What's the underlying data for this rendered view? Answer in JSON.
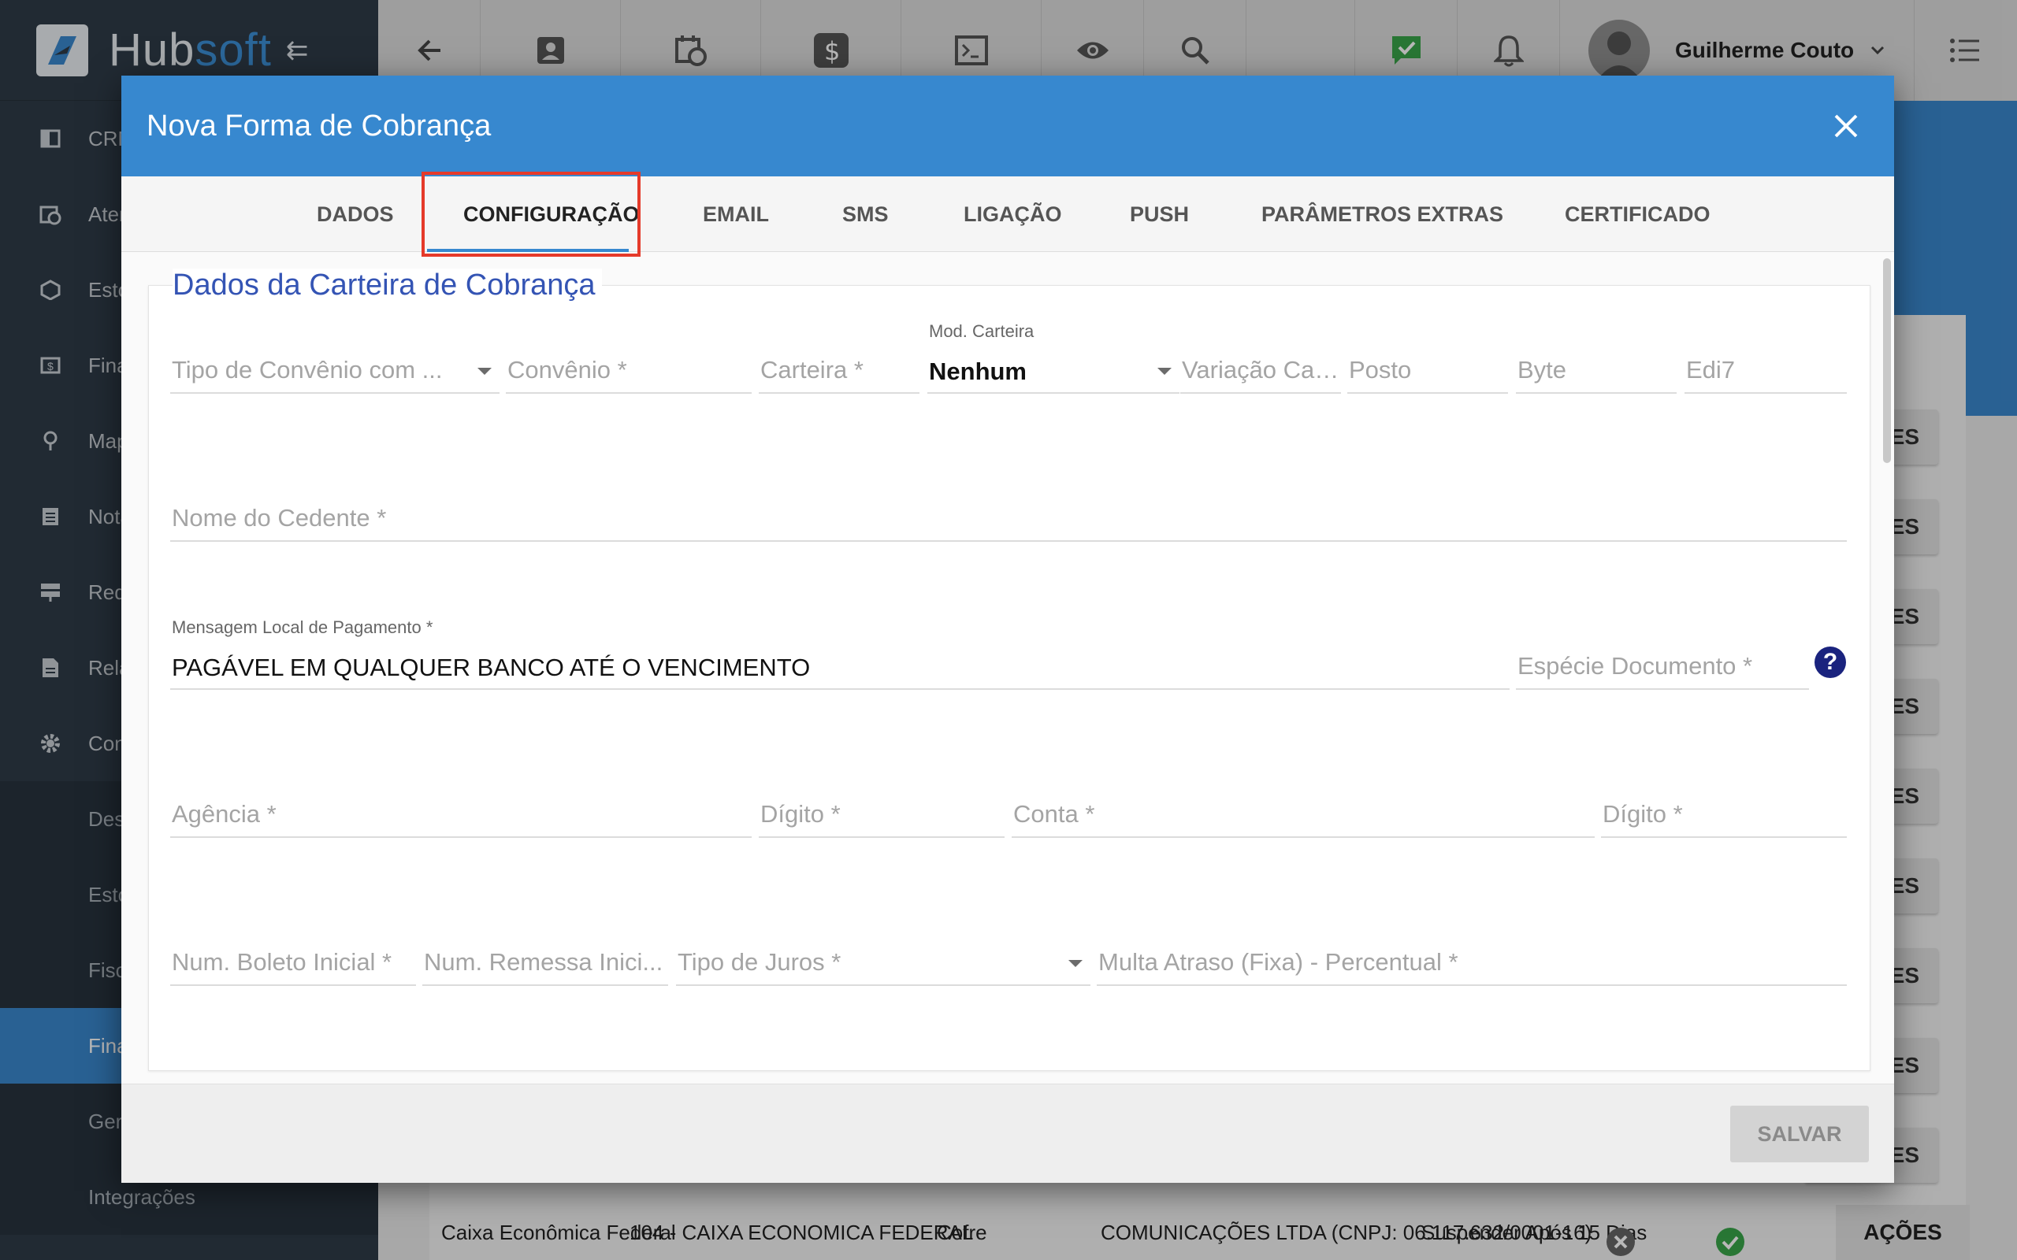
{
  "app": {
    "logo_main": "Hub",
    "logo_accent": "soft"
  },
  "sidebar": {
    "items": [
      {
        "label": "CRM",
        "icon": "crm-icon"
      },
      {
        "label": "Atendimento",
        "icon": "calendar-clock-icon"
      },
      {
        "label": "Estoque",
        "icon": "box-icon"
      },
      {
        "label": "Financeiro",
        "icon": "money-icon"
      },
      {
        "label": "Mapas",
        "icon": "map-pin-icon"
      },
      {
        "label": "Notas",
        "icon": "notes-icon"
      },
      {
        "label": "Redes",
        "icon": "network-icon"
      },
      {
        "label": "Relatórios",
        "icon": "report-icon"
      },
      {
        "label": "Configurações",
        "icon": "gear-icon"
      }
    ],
    "subitems": [
      {
        "label": "Despesas"
      },
      {
        "label": "Estoque"
      },
      {
        "label": "Fiscal"
      },
      {
        "label": "Financeiro",
        "active": true
      },
      {
        "label": "Geral"
      },
      {
        "label": "Integrações"
      }
    ]
  },
  "topbar": {
    "user_name": "Guilherme Couto"
  },
  "background": {
    "button_label": "AÇÕES",
    "row": {
      "col1": "Caixa Econômica Federal",
      "col2": "104 - CAIXA ECONOMICA FEDERAL",
      "col3": "Cofre",
      "col4": "COMUNICAÇÕES LTDA (CNPJ: 06.117.632/0001-16)",
      "col5": "Suspender Após 15 Dias"
    }
  },
  "modal": {
    "title": "Nova Forma de Cobrança",
    "tabs": [
      {
        "label": "DADOS"
      },
      {
        "label": "CONFIGURAÇÃO",
        "active": true
      },
      {
        "label": "EMAIL"
      },
      {
        "label": "SMS"
      },
      {
        "label": "LIGAÇÃO"
      },
      {
        "label": "PUSH"
      },
      {
        "label": "PARÂMETROS EXTRAS"
      },
      {
        "label": "CERTIFICADO"
      }
    ],
    "section_title": "Dados da Carteira de Cobrança",
    "fields": {
      "tipo_convenio": {
        "placeholder": "Tipo de Convênio com ..."
      },
      "convenio": {
        "placeholder": "Convênio *"
      },
      "carteira": {
        "placeholder": "Carteira *"
      },
      "mod_carteira": {
        "label": "Mod. Carteira",
        "value": "Nenhum"
      },
      "variacao_carteira": {
        "placeholder": "Variação Car..."
      },
      "posto": {
        "placeholder": "Posto"
      },
      "byte": {
        "placeholder": "Byte"
      },
      "edi7": {
        "placeholder": "Edi7"
      },
      "nome_cedente": {
        "placeholder": "Nome do Cedente *"
      },
      "mensagem_local": {
        "label": "Mensagem Local de Pagamento *",
        "value": "PAGÁVEL EM QUALQUER BANCO ATÉ O VENCIMENTO"
      },
      "especie_documento": {
        "placeholder": "Espécie Documento *"
      },
      "help": "?",
      "agencia": {
        "placeholder": "Agência *"
      },
      "digito_agencia": {
        "placeholder": "Dígito *"
      },
      "conta": {
        "placeholder": "Conta *"
      },
      "digito_conta": {
        "placeholder": "Dígito *"
      },
      "num_boleto_inicial": {
        "placeholder": "Num. Boleto Inicial *"
      },
      "num_remessa_inicial": {
        "placeholder": "Num. Remessa Inici..."
      },
      "tipo_juros": {
        "placeholder": "Tipo de Juros *"
      },
      "multa_atraso": {
        "placeholder": "Multa Atraso (Fixa) - Percentual *"
      }
    },
    "save_label": "SALVAR"
  },
  "colors": {
    "primary": "#3788cf",
    "sidebar": "#2f3b47",
    "highlight": "#e53a2a",
    "title": "#3454b4"
  }
}
